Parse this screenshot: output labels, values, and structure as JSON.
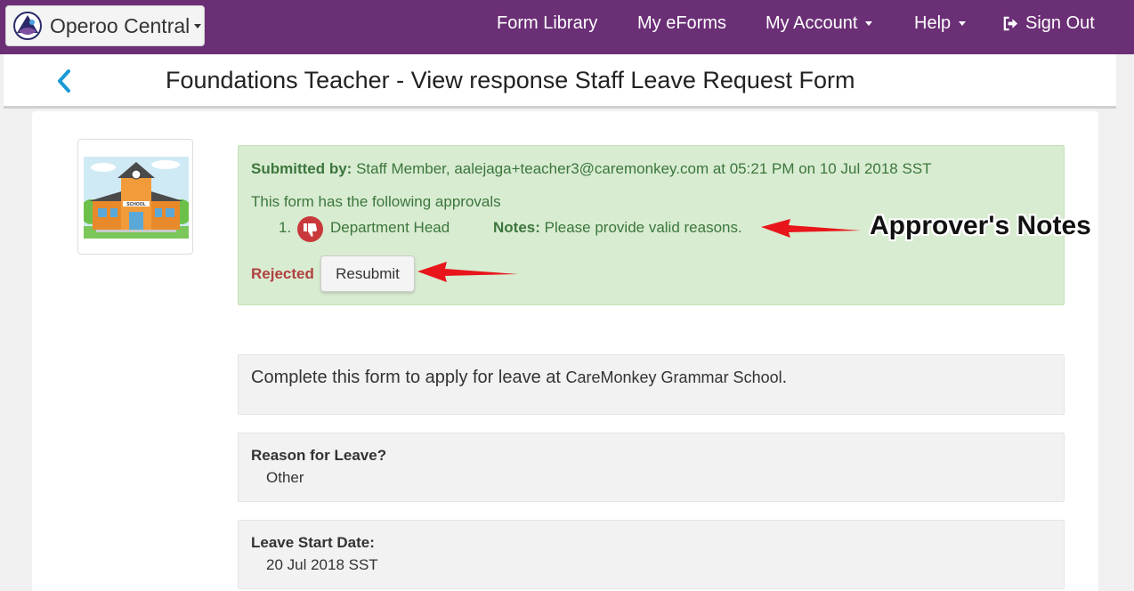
{
  "navbar": {
    "brand": "Operoo Central",
    "items": [
      {
        "label": "Form Library"
      },
      {
        "label": "My eForms"
      },
      {
        "label": "My Account"
      },
      {
        "label": "Help"
      },
      {
        "label": "Sign Out"
      }
    ]
  },
  "page": {
    "title": "Foundations Teacher - View response Staff Leave Request Form"
  },
  "status": {
    "submitted_label": "Submitted by:",
    "submitted_text": "Staff Member, aalejaga+teacher3@caremonkey.com at 05:21 PM on 10 Jul 2018 SST",
    "approvals_intro": "This form has the following approvals",
    "approvals": [
      {
        "number": "1.",
        "approver": "Department Head",
        "notes_label": "Notes:",
        "notes": "Please provide valid reasons."
      }
    ],
    "state": "Rejected",
    "resubmit_label": "Resubmit"
  },
  "annotation": {
    "label": "Approver's Notes",
    "color": "#e8161b"
  },
  "form": {
    "intro_text": "Complete this form to apply for leave at",
    "school_name": "CareMonkey Grammar School",
    "intro_end": ".",
    "questions": [
      {
        "label": "Reason for Leave?",
        "value": "Other"
      },
      {
        "label": "Leave Start Date:",
        "value": "20 Jul 2018 SST"
      }
    ]
  },
  "colors": {
    "navbar": "#6b2f76",
    "success_bg": "#d8ecd1",
    "success_text": "#3c763d",
    "rejected": "#b24040",
    "accent": "#1a9ad6"
  }
}
